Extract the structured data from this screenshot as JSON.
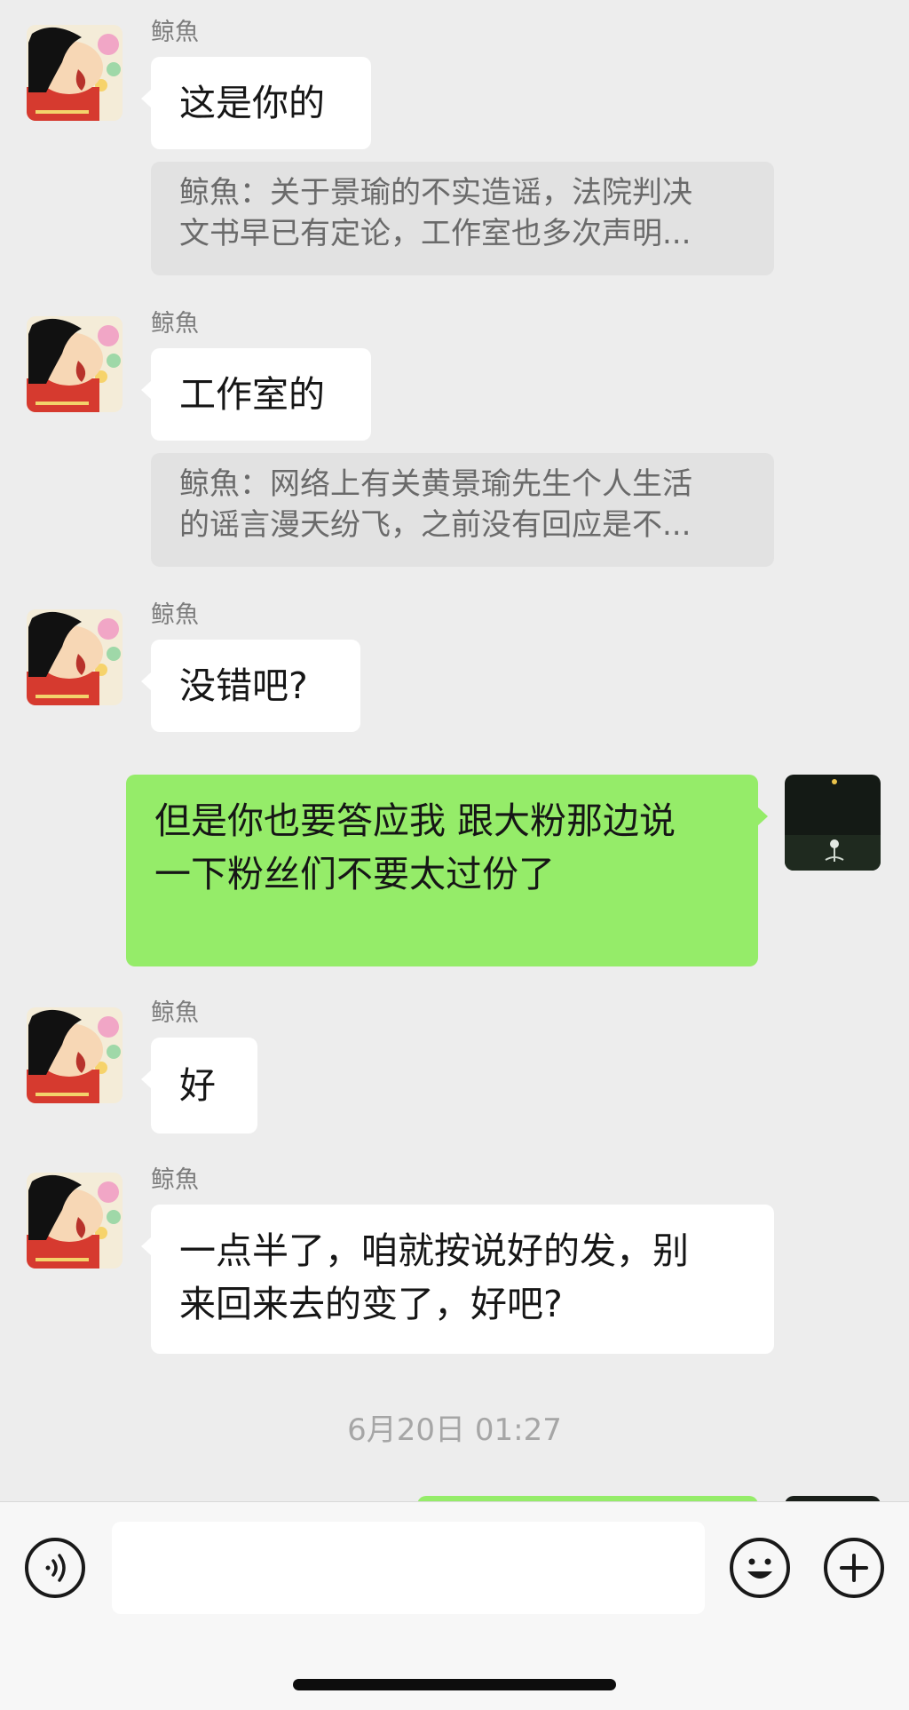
{
  "messages": [
    {
      "sender": "鲸魚",
      "text": "这是你的",
      "quote": [
        "鲸魚：关于景瑜的不实造谣，法院判决",
        "文书早已有定论，工作室也多次声明..."
      ]
    },
    {
      "sender": "鲸魚",
      "text": "工作室的",
      "quote": [
        "鲸魚：网络上有关黄景瑜先生个人生活",
        "的谣言漫天纷飞，之前没有回应是不..."
      ]
    },
    {
      "sender": "鲸魚",
      "text": "没错吧?"
    },
    {
      "self": true,
      "lines": [
        "但是你也要答应我 跟大粉那边说",
        "一下粉丝们不要太过份了"
      ]
    },
    {
      "sender": "鲸魚",
      "text": "好"
    },
    {
      "sender": "鲸魚",
      "lines": [
        "一点半了，咱就按说好的发，别",
        "来回来去的变了，好吧?"
      ]
    }
  ],
  "timestamp": "6月20日 01:27",
  "input_bar": {
    "voice_icon": "voice-input-icon",
    "emoji_icon": "emoji-icon",
    "plus_icon": "plus-icon",
    "message_value": ""
  },
  "colors": {
    "background": "#ededed",
    "outgoing_bubble": "#95ec69",
    "incoming_bubble": "#ffffff",
    "quote_background": "#e2e2e2"
  }
}
